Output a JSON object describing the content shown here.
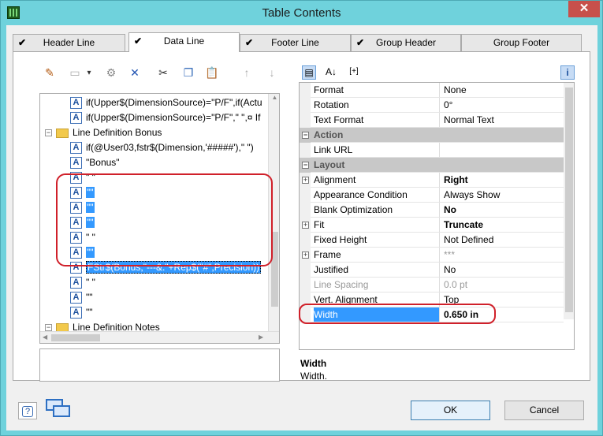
{
  "window": {
    "title": "Table Contents",
    "close_glyph": "✕"
  },
  "tabs": [
    {
      "label": "Header Line",
      "checked": true
    },
    {
      "label": "Data Line",
      "checked": true,
      "active": true
    },
    {
      "label": "Footer Line",
      "checked": true
    },
    {
      "label": "Group Header",
      "checked": true
    },
    {
      "label": "Group Footer",
      "checked": false
    }
  ],
  "toolbar": {
    "icons": [
      "wizard-icon",
      "new-field-icon",
      "dropdown-arrow-icon",
      "properties-icon",
      "delete-icon",
      "cut-icon",
      "copy-icon",
      "paste-icon",
      "move-up-icon",
      "move-down-icon"
    ],
    "glyphs": [
      "✎",
      "▭",
      "▾",
      "⚙",
      "✕",
      "✂",
      "❐",
      "📋",
      "↑",
      "↓"
    ]
  },
  "tree": {
    "rows": [
      {
        "type": "field",
        "text": "if(Upper$(DimensionSource)=\"P/F\",if(Actu"
      },
      {
        "type": "field",
        "text": "if(Upper$(DimensionSource)=\"P/F\",\" \",¤ If"
      },
      {
        "type": "folder",
        "text": "Line Definition Bonus"
      },
      {
        "type": "field",
        "text": "if(@User03,fstr$(Dimension,'#####'),\" \")"
      },
      {
        "type": "field",
        "text": "\"Bonus\""
      },
      {
        "type": "field",
        "text": "\" \""
      },
      {
        "type": "field",
        "text": "\"\"",
        "selected": true
      },
      {
        "type": "field",
        "text": "\"\"",
        "selected": true
      },
      {
        "type": "field",
        "text": "\"\"",
        "selected": true
      },
      {
        "type": "field",
        "text": "\" \""
      },
      {
        "type": "field",
        "text": "\"\"",
        "selected": true
      },
      {
        "type": "field",
        "text": "FStr$(Bonus,\"---&.\"+Rep$(\"#\",Precision))",
        "selected": true,
        "focused": true
      },
      {
        "type": "field",
        "text": "\" \""
      },
      {
        "type": "field",
        "text": "\"\""
      },
      {
        "type": "field",
        "text": "\"\""
      },
      {
        "type": "folder",
        "text": "Line Definition Notes"
      },
      {
        "type": "field",
        "text": "\"\""
      }
    ]
  },
  "props_toolbar": {
    "icons": [
      "categorized-icon",
      "sort-az-icon",
      "expand-all-icon",
      "info-icon"
    ],
    "glyphs": [
      "▤",
      "A↓",
      "[+]",
      "i"
    ]
  },
  "properties": [
    {
      "name": "Format",
      "value": "None"
    },
    {
      "name": "Rotation",
      "value": "0°"
    },
    {
      "name": "Text Format",
      "value": "Normal Text"
    },
    {
      "category": "Action"
    },
    {
      "name": "Link URL",
      "value": ""
    },
    {
      "category": "Layout"
    },
    {
      "name": "Alignment",
      "value": "Right",
      "bold": true,
      "expandable": true
    },
    {
      "name": "Appearance Condition",
      "value": "Always Show"
    },
    {
      "name": "Blank Optimization",
      "value": "No",
      "bold": true
    },
    {
      "name": "Fit",
      "value": "Truncate",
      "bold": true,
      "expandable": true
    },
    {
      "name": "Fixed Height",
      "value": "Not Defined"
    },
    {
      "name": "Frame",
      "value": "***",
      "expandable": true,
      "dim_value": true
    },
    {
      "name": "Justified",
      "value": "No"
    },
    {
      "name": "Line Spacing",
      "value": "0.0 pt",
      "disabled": true
    },
    {
      "name": "Vert. Alignment",
      "value": "Top"
    },
    {
      "name": "Width",
      "value": "0.650 in",
      "selected": true
    }
  ],
  "description": {
    "title": "Width",
    "text": "Width."
  },
  "buttons": {
    "help_icon": "?",
    "ok": "OK",
    "cancel": "Cancel"
  },
  "colors": {
    "title_bar": "#6fd2dc",
    "selection": "#3399ff",
    "annotation": "#d0202a"
  }
}
